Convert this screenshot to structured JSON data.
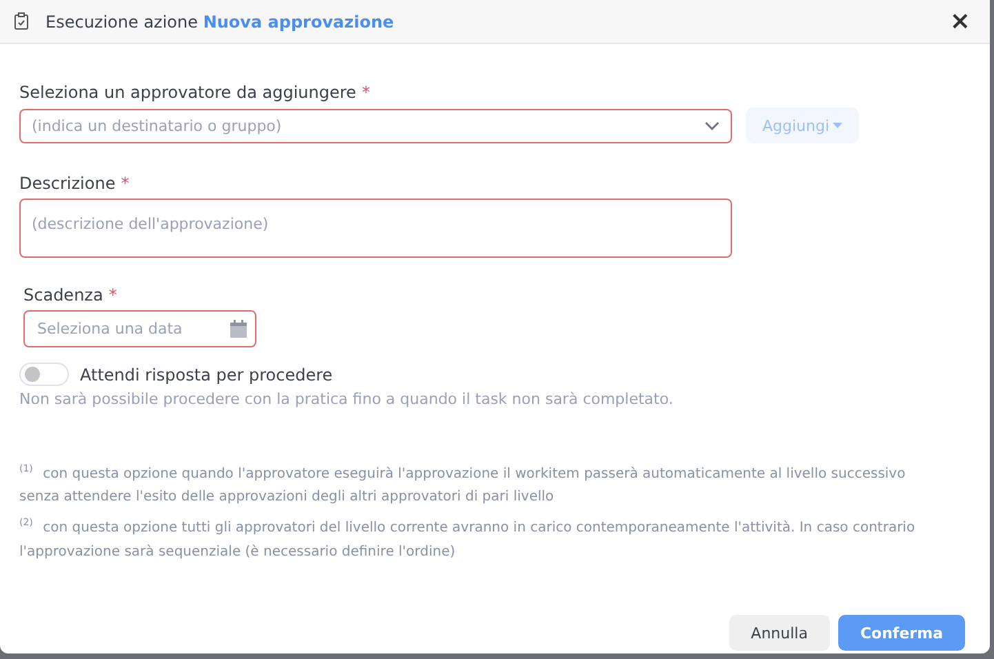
{
  "dialog": {
    "title_prefix": "Esecuzione azione",
    "title_highlight": "Nuova approvazione",
    "close": "×"
  },
  "approver": {
    "label": "Seleziona un approvatore da aggiungere",
    "required": "*",
    "placeholder": "(indica un destinatario o gruppo)",
    "add_button": "Aggiungi",
    "add_disabled": true
  },
  "description": {
    "label": "Descrizione",
    "required": "*",
    "placeholder": "(descrizione dell'approvazione)"
  },
  "deadline": {
    "label": "Scadenza",
    "required": "*",
    "placeholder": "Seleziona una data"
  },
  "wait_toggle": {
    "label": "Attendi risposta per procedere",
    "on": false,
    "hint": "Non sarà possibile procedere con la pratica fino a quando il task non sarà completato."
  },
  "footnotes": [
    "$^{(1)}$ con questa opzione quando l'approvatore eseguirà l'approvazione il workitem passerà automaticamente al livello successivo senza attendere l'esito delle approvazioni degli altri approvatori di pari livello",
    "$^{(2)}$ con questa opzione tutti gli approvatori del livello corrente avranno in carico contemporaneamente l'attività. In caso contrario l'approvazione sarà sequenziale (è necessario definire l'ordine)"
  ],
  "buttons": [
    {
      "label": "Annulla",
      "kind": "secondary"
    },
    {
      "label": "Conferma",
      "kind": "primary"
    }
  ]
}
